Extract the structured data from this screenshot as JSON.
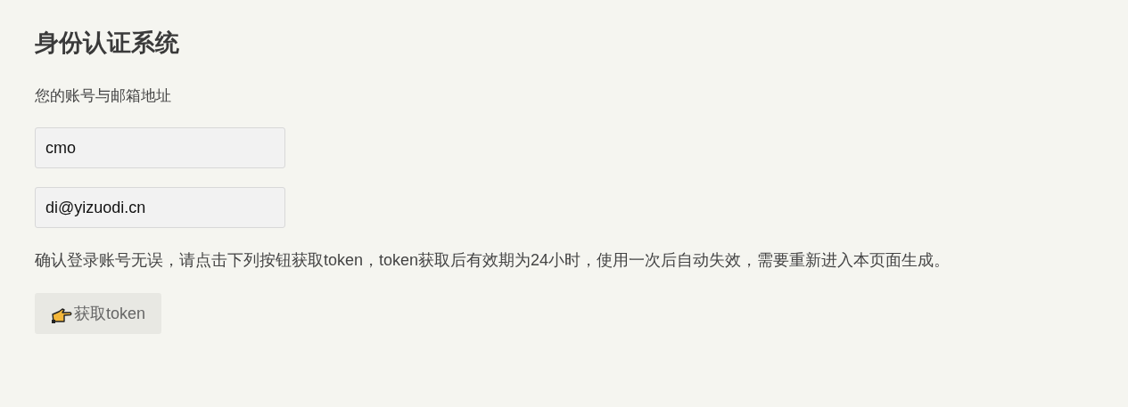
{
  "title": "身份认证系统",
  "label": "您的账号与邮箱地址",
  "fields": [
    {
      "value": "cmo"
    },
    {
      "value": "di@yizuodi.cn"
    }
  ],
  "notice": "确认登录账号无误，请点击下列按钮获取token，token获取后有效期为24小时，使用一次后自动失效，需要重新进入本页面生成。",
  "button": {
    "label": "获取token"
  }
}
